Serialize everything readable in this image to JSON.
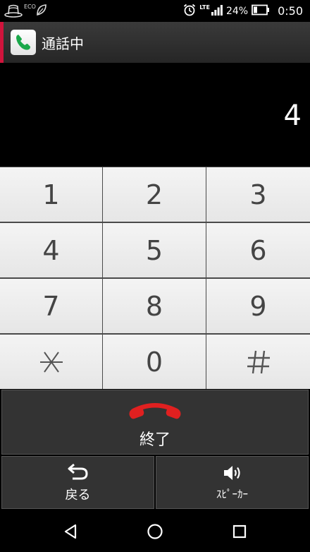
{
  "status_bar": {
    "eco_label": "ECO",
    "network": "LTE",
    "battery": "24%",
    "time": "0:50",
    "icons": [
      "hat-icon",
      "leaf-icon",
      "alarm-icon",
      "signal-icon",
      "battery-icon"
    ]
  },
  "title_bar": {
    "title": "通話中",
    "app_icon": "phone-icon",
    "accent_color": "#d0143c"
  },
  "display": {
    "dialed_number": "4"
  },
  "keypad": {
    "keys": [
      "1",
      "2",
      "3",
      "4",
      "5",
      "6",
      "7",
      "8",
      "9",
      "*",
      "0",
      "#"
    ]
  },
  "end_call": {
    "label": "終了",
    "icon": "hang-up-icon",
    "icon_color": "#e02020"
  },
  "bottom_buttons": {
    "back": {
      "label": "戻る",
      "icon": "undo-arrow-icon"
    },
    "speaker": {
      "label": "ｽﾋﾟｰｶｰ",
      "icon": "speaker-icon"
    }
  },
  "nav_bar": {
    "buttons": [
      "back-triangle-icon",
      "home-circle-icon",
      "recents-square-icon"
    ]
  }
}
